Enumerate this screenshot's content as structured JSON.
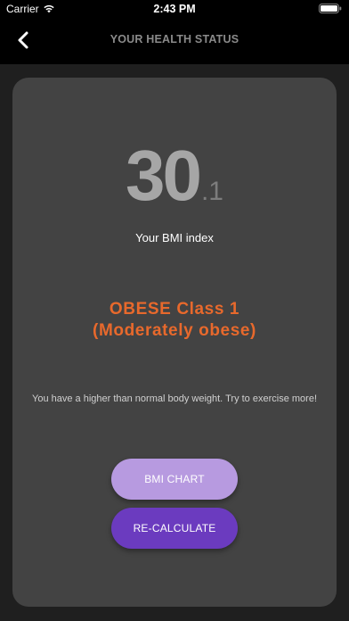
{
  "status_bar": {
    "carrier": "Carrier",
    "time": "2:43 PM"
  },
  "nav": {
    "title": "YOUR HEALTH STATUS",
    "back_icon": "chevron-left-icon"
  },
  "result": {
    "bmi_integer": "30",
    "bmi_decimal": ".1",
    "caption": "Your BMI index",
    "category_line1": "OBESE Class 1",
    "category_line2": "(Moderately obese)",
    "advice": "You have a higher than normal body weight. Try to exercise more!"
  },
  "buttons": {
    "chart_label": "BMI CHART",
    "recalculate_label": "RE-CALCULATE"
  },
  "colors": {
    "category": "#e8692c",
    "chart_button": "#b79ae0",
    "recalculate_button": "#6b3bbf",
    "card": "#434343"
  }
}
